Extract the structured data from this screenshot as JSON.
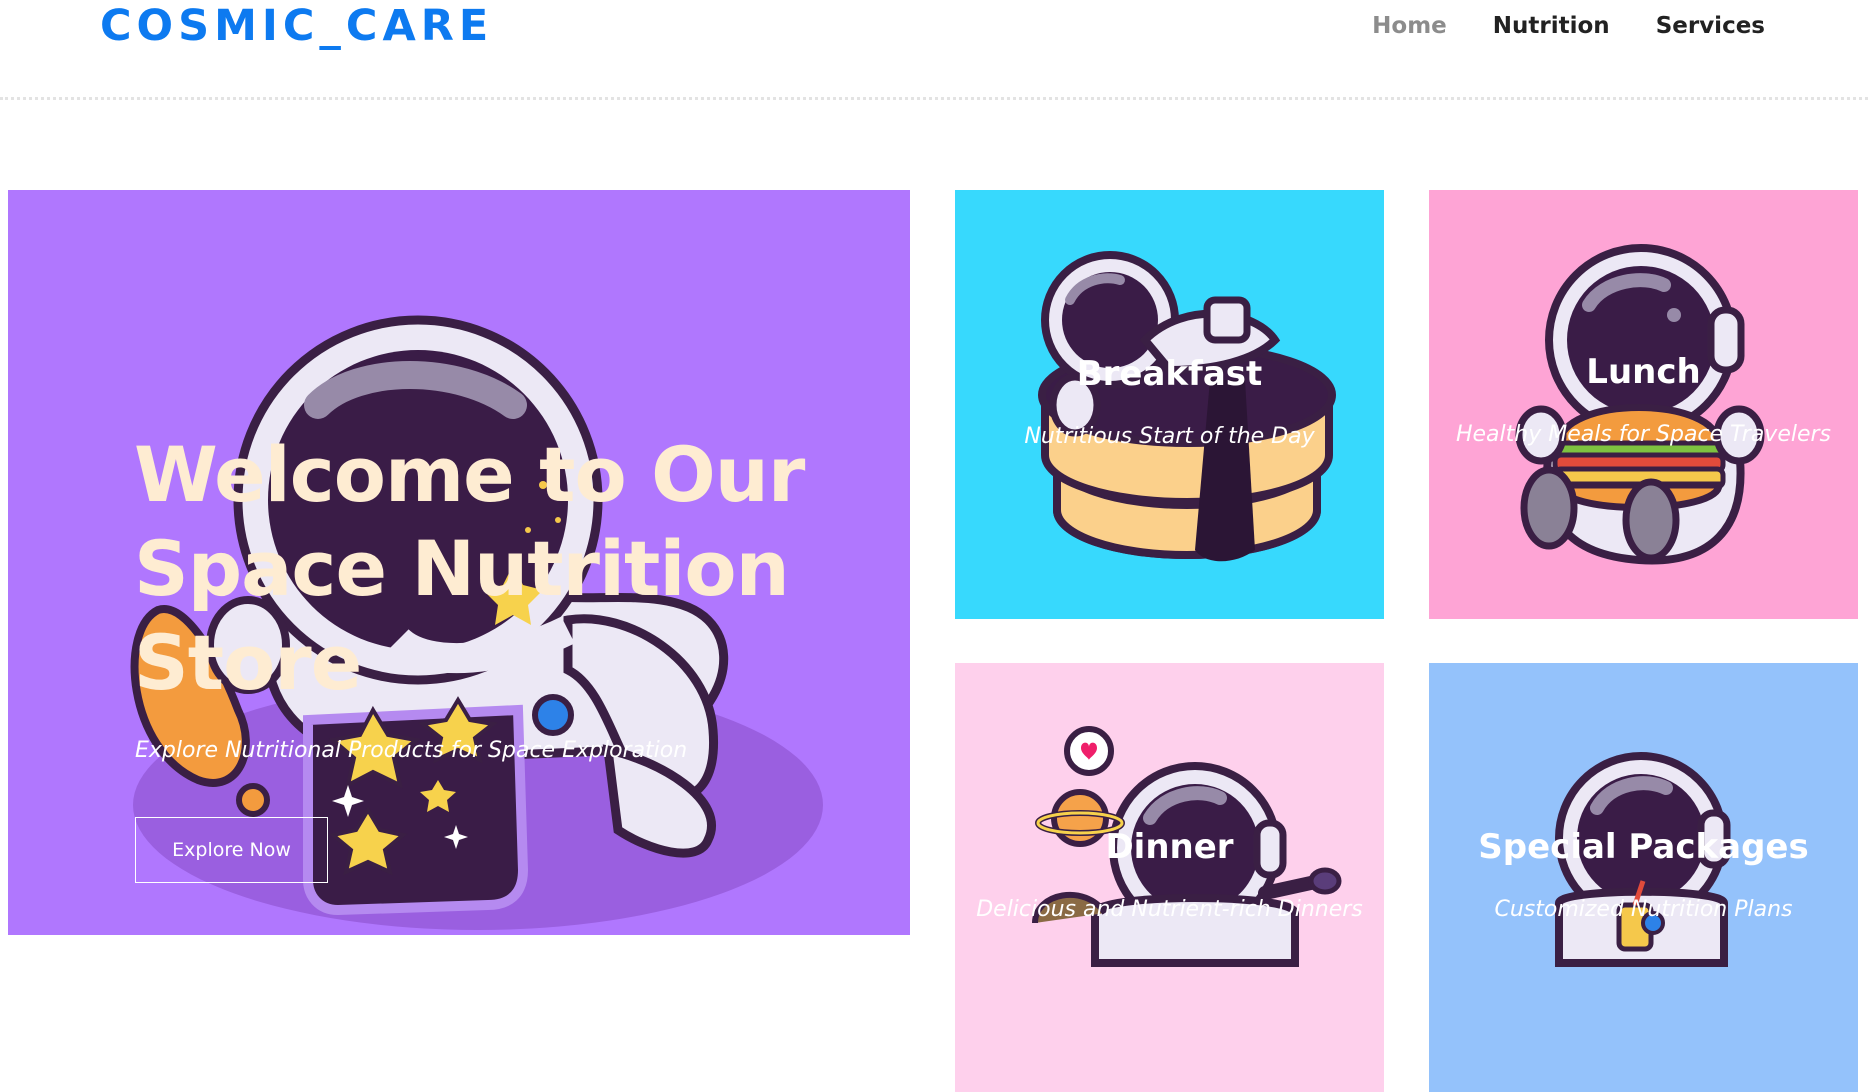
{
  "brand": {
    "logo": "COSMIC_CARE",
    "accent_color": "#0d7af0"
  },
  "nav": {
    "items": [
      "Home",
      "Nutrition",
      "Services"
    ],
    "active": "Home"
  },
  "hero": {
    "title": "Welcome to Our Space Nutrition Store",
    "subtitle": "Explore Nutritional Products for Space Exploration",
    "button_label": "Explore Now",
    "background_color": "#b077fe"
  },
  "cards": [
    {
      "title": "Breakfast",
      "subtitle": "Nutritious Start of the Day",
      "color": "#37d9fd",
      "icon": "astronaut-pancake-icon"
    },
    {
      "title": "Lunch",
      "subtitle": "Healthy Meals for Space Travelers",
      "color": "#fea4d5",
      "icon": "astronaut-burger-icon"
    },
    {
      "title": "Dinner",
      "subtitle": "Delicious and Nutrient-rich Dinners",
      "color": "#fed0ec",
      "icon": "astronaut-planet-icon"
    },
    {
      "title": "Special Packages",
      "subtitle": "Customized Nutrition Plans",
      "color": "#94c2fb",
      "icon": "astronaut-drink-icon"
    }
  ]
}
